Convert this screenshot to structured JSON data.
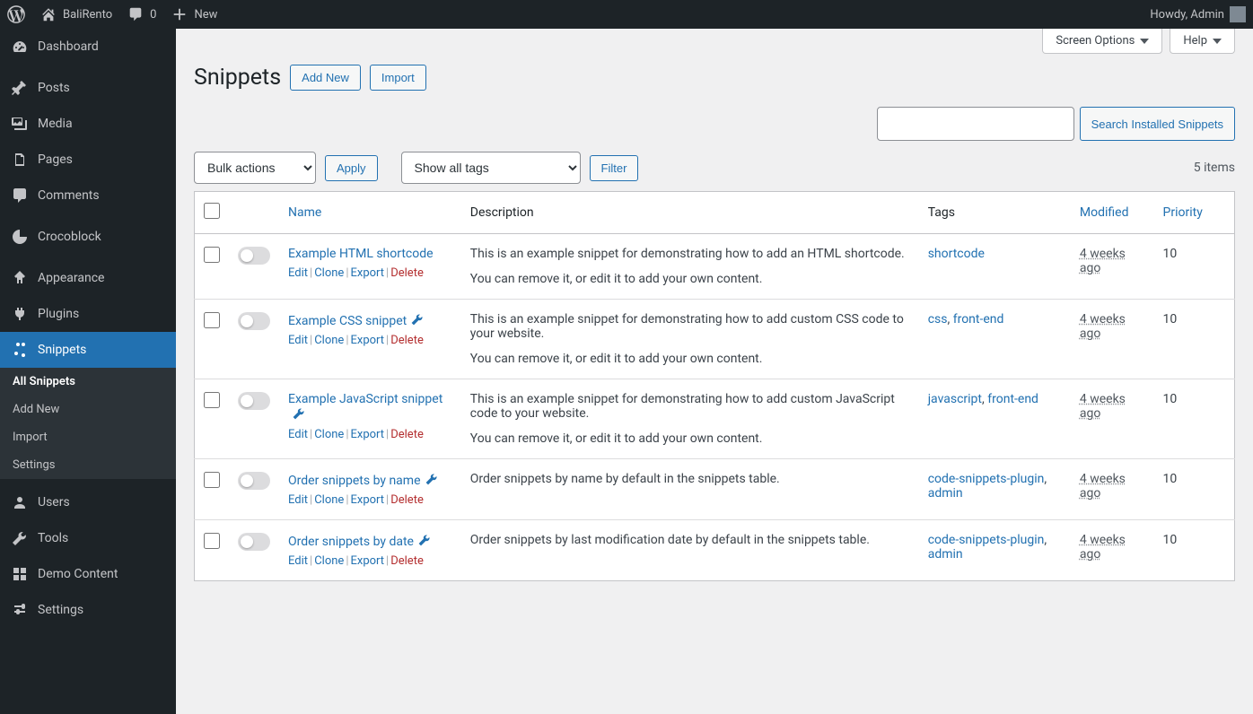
{
  "adminbar": {
    "site_name": "BaliRento",
    "comment_count": "0",
    "new_label": "New",
    "greeting": "Howdy, Admin"
  },
  "sidebar": {
    "items": [
      {
        "label": "Dashboard",
        "icon": "dashboard"
      },
      {
        "label": "Posts",
        "icon": "pin"
      },
      {
        "label": "Media",
        "icon": "media"
      },
      {
        "label": "Pages",
        "icon": "pages"
      },
      {
        "label": "Comments",
        "icon": "comments"
      },
      {
        "label": "Crocoblock",
        "icon": "croco"
      },
      {
        "label": "Appearance",
        "icon": "appearance"
      },
      {
        "label": "Plugins",
        "icon": "plugins"
      },
      {
        "label": "Snippets",
        "icon": "snippets",
        "active": true
      },
      {
        "label": "Users",
        "icon": "users"
      },
      {
        "label": "Tools",
        "icon": "tools"
      },
      {
        "label": "Demo Content",
        "icon": "demo"
      },
      {
        "label": "Settings",
        "icon": "settings"
      }
    ],
    "snippets_submenu": [
      "All Snippets",
      "Add New",
      "Import",
      "Settings"
    ],
    "submenu_active": "All Snippets"
  },
  "screen_meta": {
    "screen_options": "Screen Options",
    "help": "Help"
  },
  "page": {
    "title": "Snippets",
    "add_new": "Add New",
    "import": "Import",
    "search_btn": "Search Installed Snippets",
    "bulk_label": "Bulk actions",
    "apply": "Apply",
    "tags_label": "Show all tags",
    "filter": "Filter",
    "items_text": "5 items"
  },
  "columns": {
    "name": "Name",
    "description": "Description",
    "tags": "Tags",
    "modified": "Modified",
    "priority": "Priority"
  },
  "row_actions": {
    "edit": "Edit",
    "clone": "Clone",
    "export": "Export",
    "delete": "Delete"
  },
  "rows": [
    {
      "title": "Example HTML shortcode",
      "desc1": "This is an example snippet for demonstrating how to add an HTML shortcode.",
      "desc2": "You can remove it, or edit it to add your own content.",
      "tags": [
        "shortcode"
      ],
      "modified": "4 weeks ago",
      "priority": "10",
      "wrench": false
    },
    {
      "title": "Example CSS snippet",
      "desc1": "This is an example snippet for demonstrating how to add custom CSS code to your website.",
      "desc2": "You can remove it, or edit it to add your own content.",
      "tags": [
        "css",
        "front-end"
      ],
      "modified": "4 weeks ago",
      "priority": "10",
      "wrench": true
    },
    {
      "title": "Example JavaScript snippet",
      "desc1": "This is an example snippet for demonstrating how to add custom JavaScript code to your website.",
      "desc2": "You can remove it, or edit it to add your own content.",
      "tags": [
        "javascript",
        "front-end"
      ],
      "modified": "4 weeks ago",
      "priority": "10",
      "wrench": true
    },
    {
      "title": "Order snippets by name",
      "desc1": "Order snippets by name by default in the snippets table.",
      "desc2": "",
      "tags": [
        "code-snippets-plugin",
        "admin"
      ],
      "modified": "4 weeks ago",
      "priority": "10",
      "wrench": true
    },
    {
      "title": "Order snippets by date",
      "desc1": "Order snippets by last modification date by default in the snippets table.",
      "desc2": "",
      "tags": [
        "code-snippets-plugin",
        "admin"
      ],
      "modified": "4 weeks ago",
      "priority": "10",
      "wrench": true
    }
  ]
}
